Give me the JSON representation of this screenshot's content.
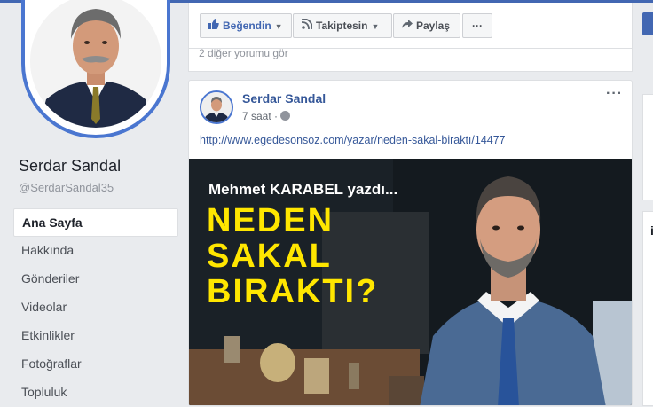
{
  "profile": {
    "name": "Serdar Sandal",
    "handle": "@SerdarSandal35"
  },
  "nav": {
    "items": [
      {
        "label": "Ana Sayfa",
        "active": true
      },
      {
        "label": "Hakkında"
      },
      {
        "label": "Gönderiler"
      },
      {
        "label": "Videolar"
      },
      {
        "label": "Etkinlikler"
      },
      {
        "label": "Fotoğraflar"
      },
      {
        "label": "Topluluk"
      }
    ]
  },
  "actionbar": {
    "liked_label": "Beğendin",
    "following_label": "Takiptesin",
    "share_label": "Paylaş",
    "more_label": "···"
  },
  "comments": {
    "more_label": "2 diğer yorumu gör"
  },
  "post": {
    "author": "Serdar Sandal",
    "time": "7 saat ·",
    "link": "http://www.egedesonsoz.com/yazar/neden-sakal-biraktı/14477",
    "more_label": "···",
    "image": {
      "overline": "Mehmet KARABEL yazdı...",
      "headline": [
        "NEDEN",
        "SAKAL",
        "BIRAKTI?"
      ]
    }
  },
  "right": {
    "letter": "i"
  },
  "colors": {
    "brand": "#4267b2",
    "link": "#365899",
    "headline_yellow": "#ffe600"
  }
}
